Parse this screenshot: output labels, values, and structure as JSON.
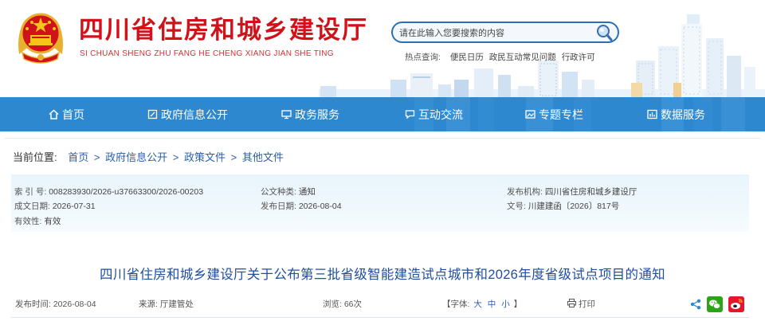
{
  "header": {
    "title": "四川省住房和城乡建设厅",
    "subtitle": "SI CHUAN SHENG ZHU FANG HE CHENG XIANG JIAN SHE TING",
    "search": {
      "placeholder": "请在此输入您要搜索的内容"
    },
    "hot_search": {
      "label": "热点查询:",
      "links": [
        "便民日历",
        "政民互动常见问题",
        "行政许可"
      ]
    }
  },
  "nav": {
    "items": [
      {
        "label": "首页",
        "icon": "home-icon"
      },
      {
        "label": "政府信息公开",
        "icon": "document-edit-icon"
      },
      {
        "label": "政务服务",
        "icon": "monitor-icon"
      },
      {
        "label": "互动交流",
        "icon": "chat-icon"
      },
      {
        "label": "专题专栏",
        "icon": "image-icon"
      },
      {
        "label": "数据服务",
        "icon": "data-chart-icon"
      }
    ]
  },
  "breadcrumb": {
    "label": "当前位置:",
    "items": [
      "首页",
      "政府信息公开",
      "政策文件",
      "其他文件"
    ],
    "separator": ">"
  },
  "meta": {
    "index_no": {
      "key": "索 引 号:",
      "value": "008283930/2026-u37663300/2026-00203"
    },
    "doc_type": {
      "key": "公文种类:",
      "value": "通知"
    },
    "publisher": {
      "key": "发布机构:",
      "value": "四川省住房和城乡建设厅"
    },
    "created_date": {
      "key": "成文日期:",
      "value": "2026-07-31"
    },
    "publish_date": {
      "key": "发布日期:",
      "value": "2026-08-04"
    },
    "doc_no": {
      "key": "文号:",
      "value": "川建建函〔2026〕817号"
    },
    "validity": {
      "key": "有效性:",
      "value": "有效"
    }
  },
  "article": {
    "title": "四川省住房和城乡建设厅关于公布第三批省级智能建造试点城市和2026年度省级试点项目的通知",
    "publish_time_label": "发布时间:",
    "publish_time": "2026-08-04",
    "source_label": "来源:",
    "source": "厅建管处",
    "views_label": "浏览:",
    "views": "66次",
    "font_label_open": "【字体:",
    "font_sizes": [
      "大",
      "中",
      "小"
    ],
    "font_label_close": "】",
    "print_label": "打印"
  },
  "colors": {
    "brand_red": "#d0121b",
    "nav_blue": "#2e88cf",
    "link_blue": "#2a5ea8",
    "title_blue": "#1f4fa0"
  }
}
